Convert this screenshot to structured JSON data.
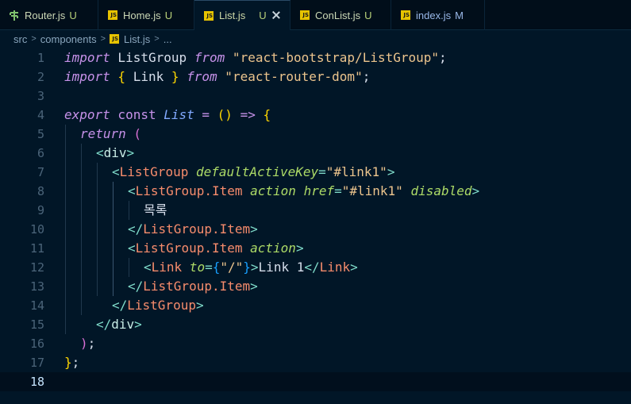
{
  "tabs": [
    {
      "name": "Router.js",
      "status": "U",
      "icon": "router-icon",
      "active": false,
      "width": 124,
      "color": "#ccd8b6",
      "status_color": "#b9d27a"
    },
    {
      "name": "Home.js",
      "status": "U",
      "icon": "js-file-icon",
      "active": false,
      "width": 121,
      "color": "#ccd8b6",
      "status_color": "#b9d27a"
    },
    {
      "name": "List.js",
      "status": "U",
      "icon": "js-file-icon",
      "active": true,
      "width": 121,
      "color": "#cdd9a8",
      "status_color": "#b9d27a"
    },
    {
      "name": "ConList.js",
      "status": "U",
      "icon": "js-file-icon",
      "active": false,
      "width": 127,
      "color": "#ccd8b6",
      "status_color": "#b9d27a"
    },
    {
      "name": "index.js",
      "status": "M",
      "icon": "js-file-icon",
      "active": false,
      "width": 118,
      "color": "#9ab8e8",
      "status_color": "#9ab8e8"
    }
  ],
  "breadcrumb": {
    "items": [
      "src",
      "components",
      "List.js",
      "..."
    ]
  },
  "editor": {
    "current_line": 18,
    "lines": [
      {
        "n": "1"
      },
      {
        "n": "2"
      },
      {
        "n": "3"
      },
      {
        "n": "4"
      },
      {
        "n": "5"
      },
      {
        "n": "6"
      },
      {
        "n": "7"
      },
      {
        "n": "8"
      },
      {
        "n": "9"
      },
      {
        "n": "10"
      },
      {
        "n": "11"
      },
      {
        "n": "12"
      },
      {
        "n": "13"
      },
      {
        "n": "14"
      },
      {
        "n": "15"
      },
      {
        "n": "16"
      },
      {
        "n": "17"
      },
      {
        "n": "18"
      }
    ],
    "code": {
      "l1": {
        "kw": "import",
        "id": " ListGroup ",
        "from": "from",
        "str": " \"react-bootstrap/ListGroup\"",
        "end": ";"
      },
      "l2": {
        "kw": "import",
        "ob": " {",
        "id": " Link ",
        "cb": "}",
        "from": " from",
        "str": " \"react-router-dom\"",
        "end": ";"
      },
      "l4": {
        "export": "export",
        "const": " const",
        "name": " List",
        "eq": " =",
        "paren": " ()",
        "arrow": " =>",
        "brace": " {"
      },
      "l5": {
        "ret": "return",
        "paren": " ("
      },
      "l6": {
        "lt": "<",
        "tag": "div",
        "gt": ">"
      },
      "l7": {
        "lt": "<",
        "tag": "ListGroup",
        "attr": " defaultActiveKey",
        "eq": "=",
        "val": "\"#link1\"",
        "gt": ">"
      },
      "l8": {
        "lt": "<",
        "tag": "ListGroup.Item",
        "attr1": " action",
        "attr2": " href",
        "eq": "=",
        "val": "\"#link1\"",
        "attr3": " disabled",
        "gt": ">"
      },
      "l9": {
        "text": "목록"
      },
      "l10": {
        "lt": "</",
        "tag": "ListGroup.Item",
        "gt": ">"
      },
      "l11": {
        "lt": "<",
        "tag": "ListGroup.Item",
        "attr": " action",
        "gt": ">"
      },
      "l12": {
        "lt": "<",
        "tag": "Link",
        "attr": " to",
        "eq": "=",
        "ob": "{",
        "val": "\"/\"",
        "cb": "}",
        "gt": ">",
        "text": "Link 1",
        "lt2": "</",
        "tag2": "Link",
        "gt2": ">"
      },
      "l13": {
        "lt": "</",
        "tag": "ListGroup.Item",
        "gt": ">"
      },
      "l14": {
        "lt": "</",
        "tag": "ListGroup",
        "gt": ">"
      },
      "l15": {
        "lt": "</",
        "tag": "div",
        "gt": ">"
      },
      "l16": {
        "paren": ")",
        "end": ";"
      },
      "l17": {
        "brace": "}",
        "end": ";"
      }
    }
  }
}
